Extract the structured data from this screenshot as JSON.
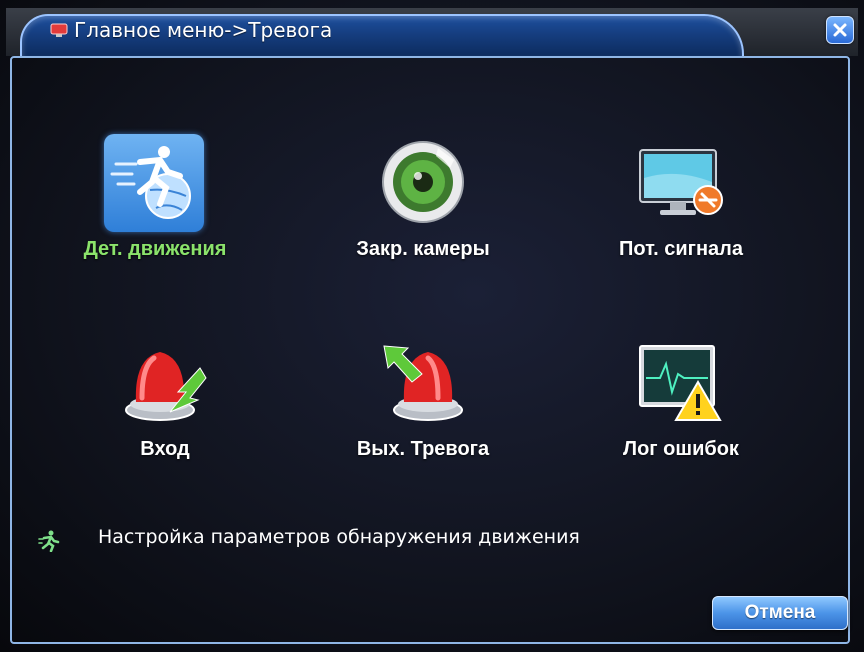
{
  "window": {
    "title": "Главное меню->Тревога",
    "close_icon": "close-icon"
  },
  "menu": {
    "items": [
      {
        "label": "Дет. движения",
        "icon": "motion-detect-icon",
        "selected": true
      },
      {
        "label": "Закр. камеры",
        "icon": "camera-blind-icon",
        "selected": false
      },
      {
        "label": "Пот. сигнала",
        "icon": "video-loss-icon",
        "selected": false
      },
      {
        "label": "Вход",
        "icon": "alarm-input-icon",
        "selected": false
      },
      {
        "label": "Вых. Тревога",
        "icon": "alarm-output-icon",
        "selected": false
      },
      {
        "label": "Лог ошибок",
        "icon": "error-log-icon",
        "selected": false
      }
    ]
  },
  "status": {
    "text": "Настройка параметров обнаружения движения",
    "icon": "running-man-icon"
  },
  "buttons": {
    "cancel_label": "Отмена"
  },
  "colors": {
    "accent": "#2f7fd8",
    "selected_label": "#8be36b",
    "frame": "#8fb6e6"
  }
}
